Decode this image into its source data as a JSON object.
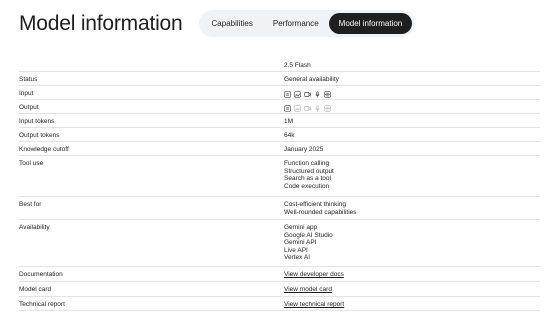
{
  "header": {
    "title": "Model information",
    "tabs": [
      {
        "label": "Capabilities",
        "active": false
      },
      {
        "label": "Performance",
        "active": false
      },
      {
        "label": "Model information",
        "active": true
      }
    ]
  },
  "table": {
    "model_name": "2.5 Flash",
    "rows": {
      "status": {
        "label": "Status",
        "value": "General availability"
      },
      "input": {
        "label": "Input",
        "icons": [
          "text-icon",
          "image-icon",
          "video-icon",
          "audio-icon",
          "pdf-icon"
        ]
      },
      "output": {
        "label": "Output",
        "icons": [
          "text-icon",
          "image-icon",
          "video-icon",
          "audio-icon",
          "pdf-icon"
        ]
      },
      "input_tokens": {
        "label": "Input tokens",
        "value": "1M"
      },
      "output_tokens": {
        "label": "Output tokens",
        "value": "64k"
      },
      "knowledge_cutoff": {
        "label": "Knowledge cutoff",
        "value": "January 2025"
      },
      "tool_use": {
        "label": "Tool use",
        "values": [
          "Function calling",
          "Structured output",
          "Search as a tool",
          "Code execution"
        ]
      },
      "best_for": {
        "label": "Best for",
        "values": [
          "Cost-efficient thinking",
          "Well-rounded capabilities"
        ]
      },
      "availability": {
        "label": "Availability",
        "values": [
          "Gemini app",
          "Google AI Studio",
          "Gemini API",
          "Live API",
          "Vertex AI"
        ]
      },
      "documentation": {
        "label": "Documentation",
        "link": "View developer docs"
      },
      "model_card": {
        "label": "Model card",
        "link": "View model card"
      },
      "technical_report": {
        "label": "Technical report",
        "link": "View technical report"
      }
    }
  }
}
